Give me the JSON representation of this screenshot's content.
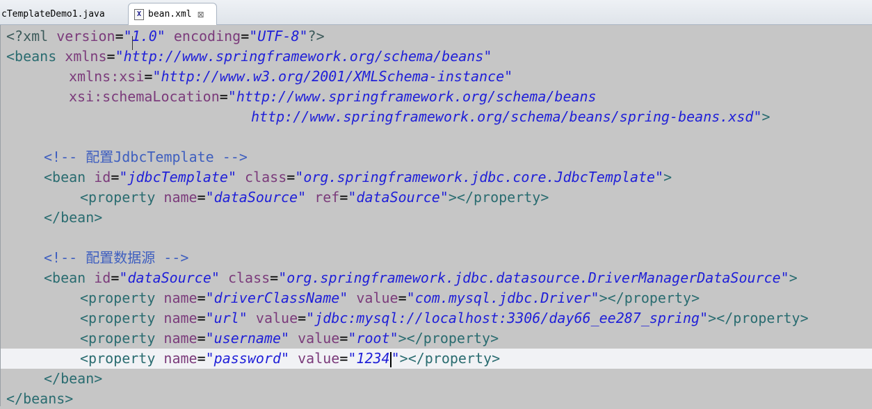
{
  "tabs": [
    {
      "label": "cTemplateDemo1.java",
      "active": false
    },
    {
      "label": "bean.xml",
      "active": true,
      "close_glyph": "⊠"
    }
  ],
  "tab_icon_glyph": "X",
  "tokens": {
    "xml_decl_open": "<?xml",
    "version_attr": "version",
    "version_val": "\"1.0\"",
    "encoding_attr": "encoding",
    "encoding_val": "\"UTF-8\"",
    "xml_decl_close": "?>",
    "beans_open": "<beans",
    "xmlns_attr": "xmlns",
    "xmlns_val": "\"http://www.springframework.org/schema/beans\"",
    "xmlns_xsi_attr": "xmlns:xsi",
    "xmlns_xsi_val": "\"http://www.w3.org/2001/XMLSchema-instance\"",
    "schema_loc_attr": "xsi:schemaLocation",
    "schema_loc_val1": "\"http://www.springframework.org/schema/beans",
    "schema_loc_val2": "http://www.springframework.org/schema/beans/spring-beans.xsd\"",
    "gt": ">",
    "comment1": "<!-- 配置JdbcTemplate -->",
    "comment2": "<!-- 配置数据源 -->",
    "bean_open": "<bean",
    "id_attr": "id",
    "class_attr": "class",
    "property_open": "<property",
    "property_close": "</property>",
    "name_attr": "name",
    "ref_attr": "ref",
    "value_attr": "value",
    "bean_close": "</bean>",
    "beans_close": "</beans>",
    "eq": "=",
    "jdbc_template_id": "\"jdbcTemplate\"",
    "jdbc_template_class": "\"org.springframework.jdbc.core.JdbcTemplate\"",
    "ds_name": "\"dataSource\"",
    "ds_ref": "\"dataSource\"",
    "ds_id": "\"dataSource\"",
    "ds_class": "\"org.springframework.jdbc.datasource.DriverManagerDataSource\"",
    "prop1_name": "\"driverClassName\"",
    "prop1_value": "\"com.mysql.jdbc.Driver\"",
    "prop2_name": "\"url\"",
    "prop2_value": "\"jdbc:mysql://localhost:3306/day66_ee287_spring\"",
    "prop3_name": "\"username\"",
    "prop3_value": "\"root\"",
    "prop4_name": "\"password\"",
    "prop4_value_open": "\"1234",
    "prop4_value_close": "\""
  }
}
